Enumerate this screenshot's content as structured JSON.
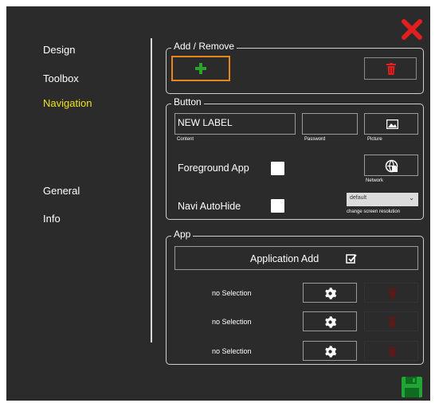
{
  "nav": {
    "design": "Design",
    "toolbox": "Toolbox",
    "navigation": "Navigation",
    "general": "General",
    "info": "Info"
  },
  "add_remove": {
    "legend": "Add / Remove"
  },
  "button": {
    "legend": "Button",
    "content_value": "NEW LABEL",
    "content_caption": "Content",
    "password_caption": "Password",
    "picture_caption": "Picture",
    "network_caption": "Network",
    "foreground_label": "Foreground App",
    "autohide_label": "Navi AutoHide",
    "resolution_value": "default",
    "resolution_caption": "change screen resolution"
  },
  "app": {
    "legend": "App",
    "add_label": "Application Add",
    "rows": [
      {
        "label": "no Selection"
      },
      {
        "label": "no Selection"
      },
      {
        "label": "no Selection"
      }
    ]
  },
  "colors": {
    "accent_active": "#f0e31a",
    "delete_red": "#e0201e",
    "add_green": "#2aa52a",
    "highlight_orange": "#e8861c",
    "save_green": "#1fa636"
  },
  "icons": [
    "close-icon",
    "plus-icon",
    "trash-icon",
    "picture-icon",
    "network-icon",
    "chevron-down-icon",
    "checkbox-edit-icon",
    "gear-icon",
    "save-icon"
  ]
}
